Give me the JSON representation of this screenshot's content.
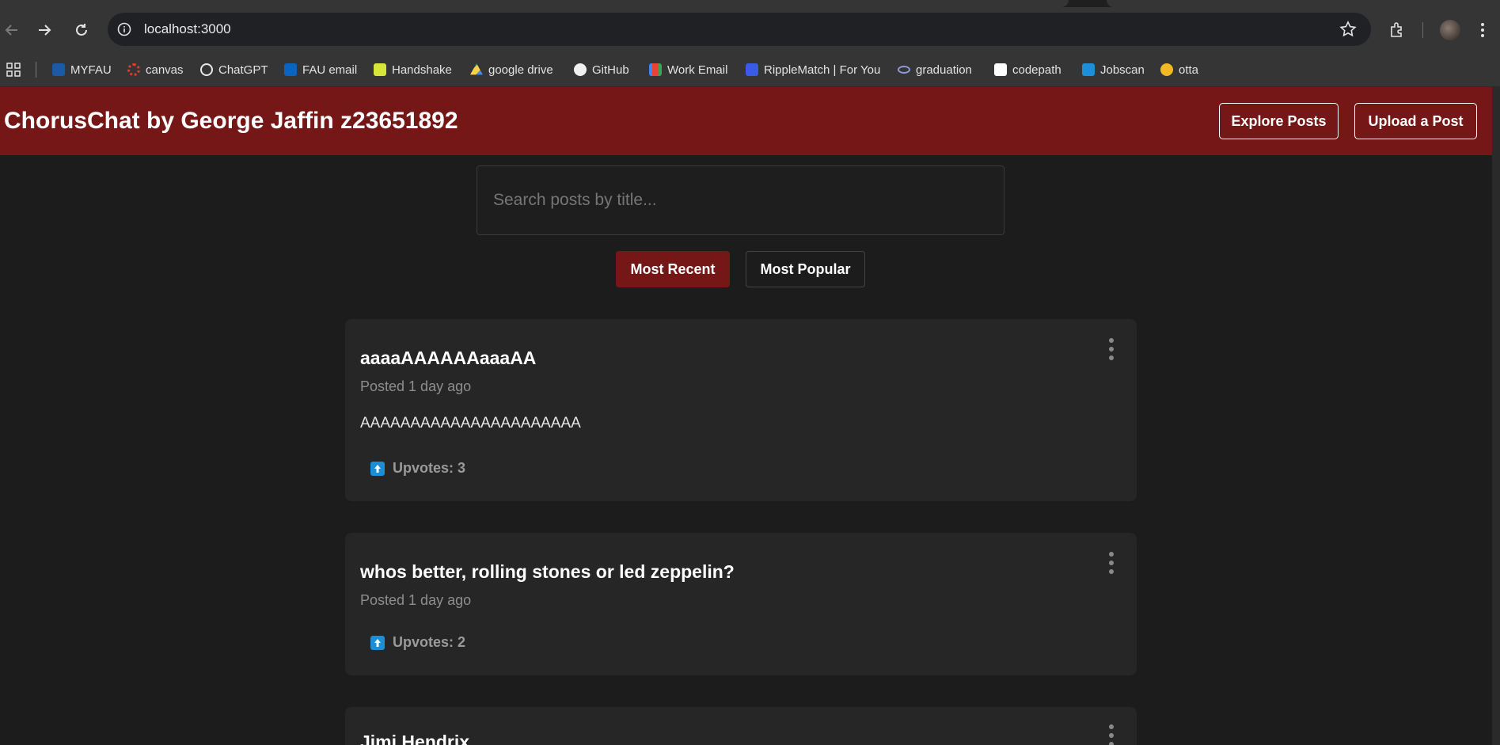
{
  "browser": {
    "url": "localhost:3000",
    "bookmarks": [
      {
        "label": "MYFAU",
        "color": "#1a5aa6"
      },
      {
        "label": "canvas",
        "color": "#e13c2c"
      },
      {
        "label": "ChatGPT",
        "color": "#e8e8e8"
      },
      {
        "label": "FAU email",
        "color": "#0a64c2"
      },
      {
        "label": "Handshake",
        "color": "#d7e638"
      },
      {
        "label": "google drive",
        "color": "#1fa463"
      },
      {
        "label": "GitHub",
        "color": "#f0f0f0"
      },
      {
        "label": "Work Email",
        "color": "#ea4335"
      },
      {
        "label": "RippleMatch | For You",
        "color": "#3a5ae8"
      },
      {
        "label": "graduation",
        "color": "#8e9ad6"
      },
      {
        "label": "codepath",
        "color": "#ffffff"
      },
      {
        "label": "Jobscan",
        "color": "#1b8fd8"
      },
      {
        "label": "otta",
        "color": "#f2b825"
      }
    ]
  },
  "header": {
    "title": "ChorusChat by George Jaffin z23651892",
    "explore_label": "Explore Posts",
    "upload_label": "Upload a Post"
  },
  "search": {
    "placeholder": "Search posts by title..."
  },
  "sort": {
    "recent_label": "Most Recent",
    "popular_label": "Most Popular"
  },
  "posts": [
    {
      "title": "aaaaAAAAAAaaaAA",
      "meta": "Posted 1 day ago",
      "body": "AAAAAAAAAAAAAAAAAAAAAA",
      "upvotes": "Upvotes: 3"
    },
    {
      "title": "whos better, rolling stones or led zeppelin?",
      "meta": "Posted 1 day ago",
      "upvotes": "Upvotes: 2"
    },
    {
      "title": "Jimi Hendrix"
    }
  ],
  "colors": {
    "accent": "#751717",
    "background": "#1c1c1c",
    "card": "#262626"
  }
}
